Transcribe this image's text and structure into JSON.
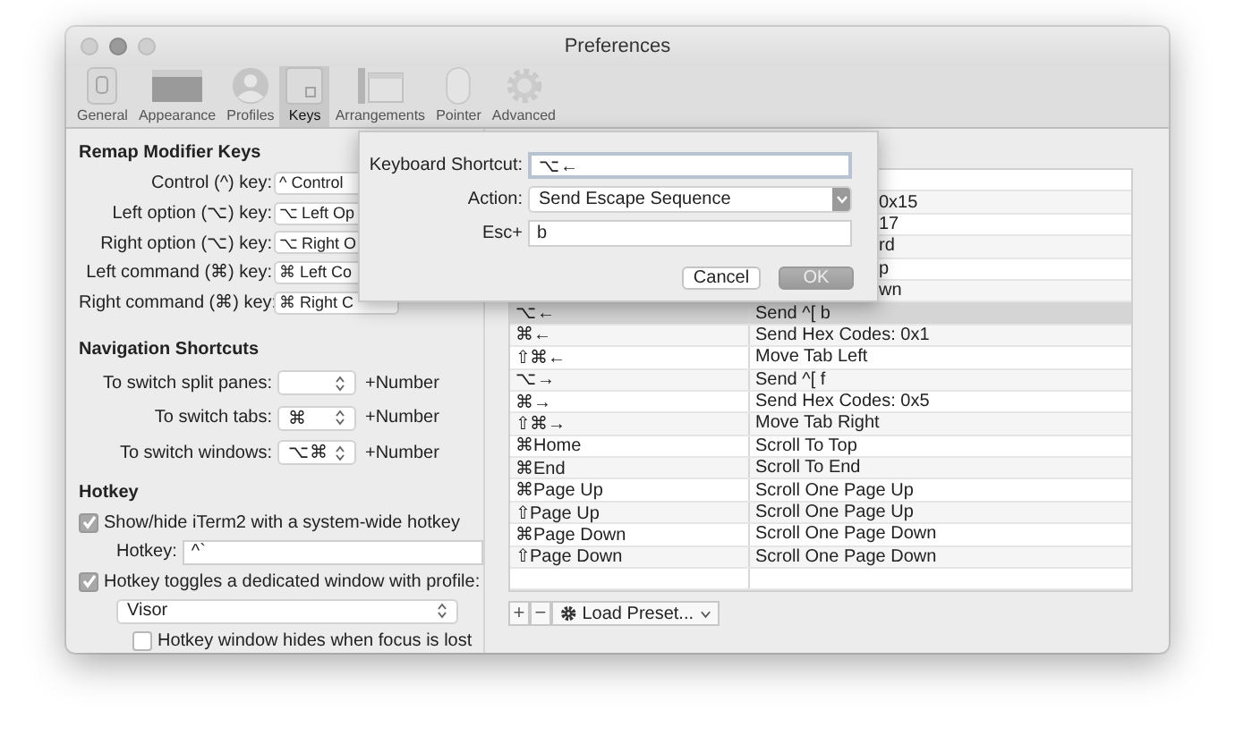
{
  "window": {
    "title": "Preferences"
  },
  "toolbar": [
    {
      "label": "General",
      "selected": false
    },
    {
      "label": "Appearance",
      "selected": false
    },
    {
      "label": "Profiles",
      "selected": false
    },
    {
      "label": "Keys",
      "selected": true
    },
    {
      "label": "Arrangements",
      "selected": false
    },
    {
      "label": "Pointer",
      "selected": false
    },
    {
      "label": "Advanced",
      "selected": false
    }
  ],
  "remap": {
    "heading": "Remap Modifier Keys",
    "rows": [
      {
        "label": "Control (^) key:",
        "value": "^ Control"
      },
      {
        "label": "Left option (⌥) key:",
        "value": "⌥ Left Op"
      },
      {
        "label": "Right option (⌥) key:",
        "value": "⌥ Right O"
      },
      {
        "label": "Left command (⌘) key:",
        "value": "⌘ Left Co"
      },
      {
        "label": "Right command (⌘) key:",
        "value": "⌘ Right C"
      }
    ]
  },
  "navigation": {
    "heading": "Navigation Shortcuts",
    "rows": [
      {
        "label": "To switch split panes:",
        "suffix": "+Number"
      },
      {
        "label": "To switch tabs:",
        "value": "⌘",
        "suffix": "+Number"
      },
      {
        "label": "To switch windows:",
        "value": "⌥⌘",
        "suffix": "+Number"
      }
    ]
  },
  "hotkey": {
    "heading": "Hotkey",
    "items": [
      {
        "kind": "checkbox",
        "label": "Show/hide iTerm2 with a system-wide hotkey",
        "checked": true
      },
      {
        "kind": "field",
        "label": "Hotkey:",
        "value": "^`"
      },
      {
        "kind": "checkbox",
        "label": "Hotkey toggles a dedicated window with profile:",
        "checked": true
      },
      {
        "kind": "popup",
        "value": "Visor"
      },
      {
        "kind": "checkbox",
        "label": "Hotkey window hides when focus is lost",
        "checked": false
      }
    ]
  },
  "key_table": {
    "rows": [
      {
        "selected": false
      },
      {
        "selected": false,
        "column_2_fragment": "0x15"
      },
      {
        "selected": false,
        "column_2_fragment": "17"
      },
      {
        "selected": false,
        "column_2_fragment": "rd"
      },
      {
        "selected": false,
        "column_2_fragment": "p"
      },
      {
        "selected": false,
        "column_2_fragment": "wn"
      },
      {
        "selected": true,
        "key": "⌥←",
        "action": "Send ^[ b"
      },
      {
        "selected": false,
        "key": "⌘←",
        "action": "Send Hex Codes: 0x1"
      },
      {
        "selected": false,
        "key": "⇧⌘←",
        "action": "Move Tab Left"
      },
      {
        "selected": false,
        "key": "⌥→",
        "action": "Send ^[ f"
      },
      {
        "selected": false,
        "key": "⌘→",
        "action": "Send Hex Codes: 0x5"
      },
      {
        "selected": false,
        "key": "⇧⌘→",
        "action": "Move Tab Right"
      },
      {
        "selected": false,
        "key": "⌘Home",
        "action": "Scroll To Top"
      },
      {
        "selected": false,
        "key": "⌘End",
        "action": "Scroll To End"
      },
      {
        "selected": false,
        "key": "⌘Page Up",
        "action": "Scroll One Page Up"
      },
      {
        "selected": false,
        "key": "⇧Page Up",
        "action": "Scroll One Page Up"
      },
      {
        "selected": false,
        "key": "⌘Page Down",
        "action": "Scroll One Page Down"
      },
      {
        "selected": false,
        "key": "⇧Page Down",
        "action": "Scroll One Page Down"
      },
      {
        "selected": false
      }
    ],
    "add_button": "+",
    "remove_button": "−",
    "preset_popup": "Load Preset..."
  },
  "sheet": {
    "rows": [
      {
        "kind": "field",
        "label": "Keyboard Shortcut:",
        "value": "⌥←",
        "focused": true
      },
      {
        "kind": "popup",
        "label": "Action:",
        "value": "Send Escape Sequence"
      },
      {
        "kind": "field",
        "label": "Esc+",
        "value": "b",
        "focused": false
      }
    ],
    "buttons": [
      {
        "label": "Cancel",
        "kind": "normal"
      },
      {
        "label": "OK",
        "kind": "default"
      }
    ]
  }
}
